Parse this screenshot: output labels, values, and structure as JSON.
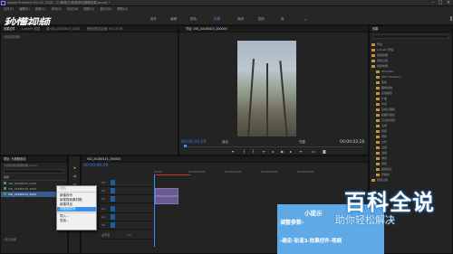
{
  "window": {
    "title": "Adobe Premiere Pro CC 2018 - D:\\教程\\为视频添加模糊效果.prproj *"
  },
  "menu": [
    "文件(F)",
    "编辑(E)",
    "剪辑(C)",
    "序列(S)",
    "标记(M)",
    "图形(G)",
    "窗口(W)",
    "帮助(H)"
  ],
  "logo": "秒懂视频",
  "workspaces": [
    "组件",
    "编辑",
    "颜色",
    "效果",
    "音频",
    "图形",
    "库"
  ],
  "active_workspace_index": 3,
  "source_panel": {
    "tabs": [
      "效果控件",
      "Lumetri 范围",
      "源:VID_20180415_2000",
      "音频剪辑混合器: VID_2018"
    ],
    "message": "(未选择剪辑)"
  },
  "program_monitor": {
    "tab": "节目: VID_20180415_200000",
    "timecode": "00;00;00;00",
    "fit": "适合",
    "quality": "完整",
    "duration": "00;00;02;26"
  },
  "effects_panel": {
    "tab": "效果",
    "items": [
      "预设",
      "Lumetri 预设",
      "音频效果",
      "音频过渡",
      "视频效果",
      "Obsolete",
      "GPU Transition",
      "变换",
      "图像控制",
      "实用程序",
      "扩曲",
      "时间",
      "杂色与颗粒",
      "模糊与锐化",
      "沉浸式视频",
      "生成",
      "视频",
      "调整",
      "过时",
      "过渡",
      "透视",
      "通道",
      "键控",
      "颜色校正",
      "风格化",
      "视频过渡"
    ]
  },
  "project_panel": {
    "tab": "项目: 为视频添加",
    "file": "为视频添加模糊效果.prproj",
    "column": "名称",
    "items": [
      "VID_20180415_2000",
      "VID_20180415_2000",
      "VID_20180415_2000"
    ],
    "count": "1项已选择"
  },
  "timeline": {
    "tab": "VID_20180415_200000",
    "timecode": "00;00;00;00",
    "ruler": [
      "00;00",
      "00;00;05;00",
      "00;00;10;00",
      "00;00;15;00",
      "00;00;20;00"
    ],
    "tracks": [
      "V3",
      "V2",
      "V1",
      "A1",
      "A2",
      "A3"
    ],
    "master": "主声道",
    "master_value": "0.0"
  },
  "context_menu": {
    "items": [
      "新建序列",
      "新建搜索素材箱",
      "新建项目",
      "调整图层项",
      "导入...",
      "查找..."
    ],
    "header": "粘贴",
    "highlighted_index": 3
  },
  "tip": {
    "title": "小提示",
    "line2": "调整参数-",
    "line3": "-确定-轨道3-效果控件-视频"
  },
  "watermark": {
    "brand": "百科全说",
    "slogan": "助你轻松解决"
  },
  "colors": {
    "accent": "#3b8fe8",
    "clip": "#6a5b8e",
    "tip": "#5fa9e6"
  }
}
